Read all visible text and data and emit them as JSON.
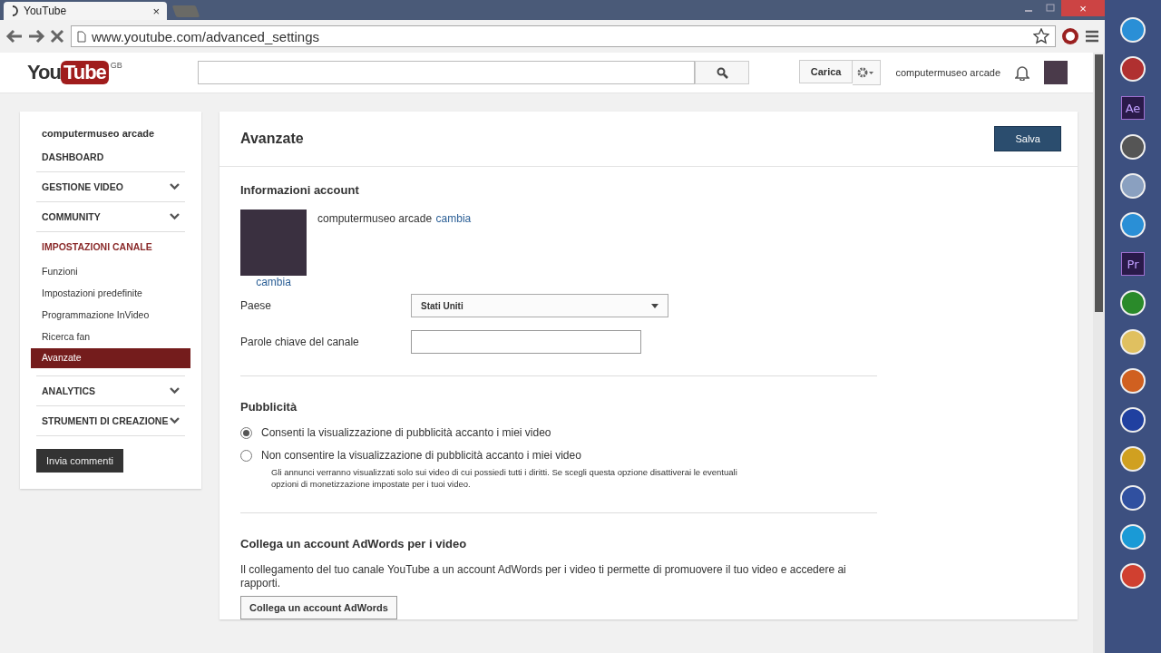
{
  "browser": {
    "tab_title": "YouTube",
    "tab_close": "×",
    "window_controls": {
      "close": "×"
    },
    "url": "www.youtube.com/advanced_settings"
  },
  "header": {
    "logo": {
      "you": "You",
      "tube": "Tube",
      "region": "GB"
    },
    "upload_button": "Carica",
    "user_name": "computermuseo arcade"
  },
  "sidebar": {
    "channel_name": "computermuseo arcade",
    "sections": [
      {
        "label": "DASHBOARD",
        "expandable": false,
        "selected": false
      },
      {
        "label": "GESTIONE VIDEO",
        "expandable": true,
        "selected": false
      },
      {
        "label": "COMMUNITY",
        "expandable": true,
        "selected": false
      },
      {
        "label": "IMPOSTAZIONI CANALE",
        "expandable": false,
        "selected": true,
        "children": [
          {
            "label": "Funzioni",
            "selected": false
          },
          {
            "label": "Impostazioni predefinite",
            "selected": false
          },
          {
            "label": "Programmazione InVideo",
            "selected": false
          },
          {
            "label": "Ricerca fan",
            "selected": false
          },
          {
            "label": "Avanzate",
            "selected": true
          }
        ]
      },
      {
        "label": "ANALYTICS",
        "expandable": true,
        "selected": false
      },
      {
        "label": "STRUMENTI DI CREAZIONE",
        "expandable": true,
        "selected": false
      }
    ],
    "feedback_button": "Invia commenti"
  },
  "main": {
    "title": "Avanzate",
    "save_button": "Salva",
    "account": {
      "heading": "Informazioni account",
      "name": "computermuseo arcade",
      "change_link": "cambia",
      "avatar_change_link": "cambia",
      "country_label": "Paese",
      "country_value": "Stati Uniti",
      "keywords_label": "Parole chiave del canale"
    },
    "ads": {
      "heading": "Pubblicità",
      "options": [
        {
          "label": "Consenti la visualizzazione di pubblicità accanto i miei video",
          "selected": true
        },
        {
          "label": "Non consentire la visualizzazione di pubblicità accanto i miei video",
          "selected": false,
          "note": "Gli annunci verranno visualizzati solo sui video di cui possiedi tutti i diritti. Se scegli questa opzione disattiverai le eventuali opzioni di monetizzazione impostate per i tuoi video."
        }
      ]
    },
    "adwords": {
      "heading": "Collega un account AdWords per i video",
      "text": "Il collegamento del tuo canale YouTube a un account AdWords per i video ti permette di promuovere il tuo video e accedere ai rapporti.",
      "button": "Collega un account AdWords"
    }
  },
  "taskbar": {
    "apps": [
      {
        "kind": "icon",
        "color": "#2a8fd6"
      },
      {
        "kind": "icon",
        "color": "#b03030"
      },
      {
        "kind": "label",
        "label": "Ae",
        "color": "#2a1a4a"
      },
      {
        "kind": "icon",
        "color": "#555555"
      },
      {
        "kind": "icon",
        "color": "#8aa0c0"
      },
      {
        "kind": "icon",
        "color": "#2a8fd6"
      },
      {
        "kind": "label",
        "label": "Pr",
        "color": "#2a1a4a"
      },
      {
        "kind": "icon",
        "color": "#2a8a2a"
      },
      {
        "kind": "icon",
        "color": "#e0c060"
      },
      {
        "kind": "icon",
        "color": "#d06020"
      },
      {
        "kind": "icon",
        "color": "#2040a0"
      },
      {
        "kind": "icon",
        "color": "#d0a020"
      },
      {
        "kind": "icon",
        "color": "#3050a0"
      },
      {
        "kind": "icon",
        "color": "#1a9ad6"
      },
      {
        "kind": "icon",
        "color": "#d04030"
      }
    ]
  }
}
